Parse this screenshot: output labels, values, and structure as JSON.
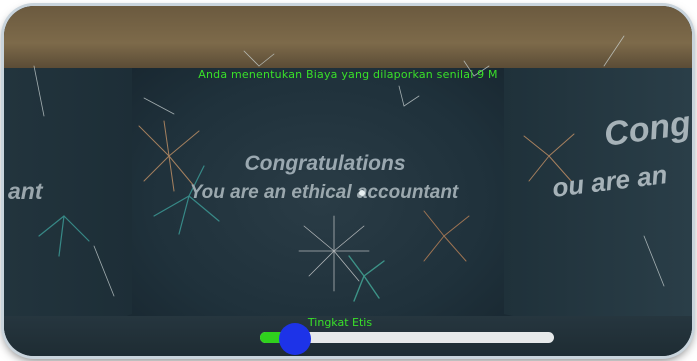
{
  "hud": {
    "message": "Anda menentukan Biaya yang dilaporkan senilai 9 M"
  },
  "walls": {
    "back_title": "Congratulations",
    "back_subtitle": "You are an ethical accountant",
    "left_fragment": "ant",
    "right_fragment_top": "Cong",
    "right_fragment_bottom": "ou are an"
  },
  "ethics_slider": {
    "label": "Tingkat Etis",
    "value_fraction": 0.12,
    "fill_color": "#2fd11d",
    "thumb_color": "#1d33e8",
    "track_color": "#e6e9ea"
  },
  "colors": {
    "hud_text": "#39e029"
  },
  "icons": {
    "crosshair": "reticle-dot-icon"
  }
}
